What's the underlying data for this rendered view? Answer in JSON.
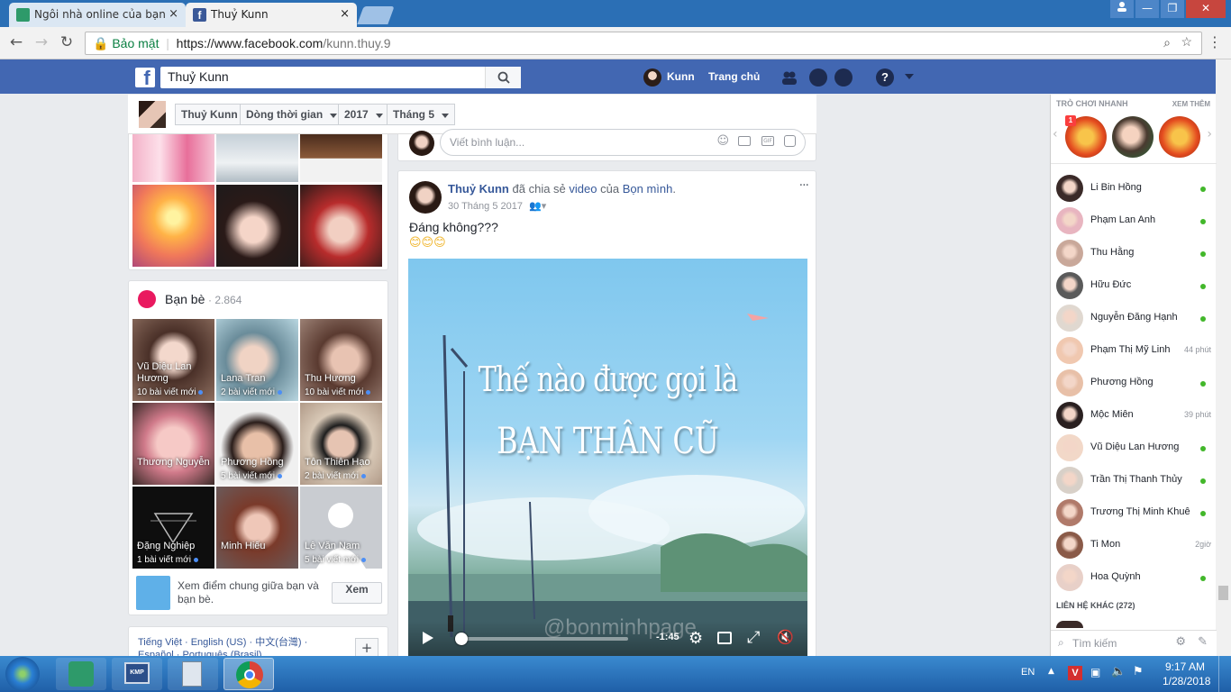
{
  "browser": {
    "tabs": [
      {
        "title": "Ngôi nhà online của bạn"
      },
      {
        "title": "Thuỷ Kunn"
      }
    ],
    "close_symbol": "×",
    "address": {
      "secure_label": "Bảo mật",
      "url_host": "https://www.facebook.com",
      "url_path": "/kunn.thuy.9"
    }
  },
  "fb_header": {
    "search_value": "Thuỷ Kunn",
    "user_name": "Kunn",
    "home_label": "Trang chủ"
  },
  "profile_nav": {
    "name_button": "Thuỷ Kunn",
    "timeline_button": "Dòng thời gian",
    "year_button": "2017",
    "month_button": "Tháng 5"
  },
  "friends": {
    "title": "Bạn bè",
    "count": "· 2.864",
    "items": [
      {
        "name": "Vũ Diệu Lan Hương",
        "posts": "10 bài viết mới"
      },
      {
        "name": "Lana Tran",
        "posts": "2 bài viết mới"
      },
      {
        "name": "Thu Hương",
        "posts": "10 bài viết mới"
      },
      {
        "name": "Thương Nguyễn",
        "posts": ""
      },
      {
        "name": "Phương Hồng",
        "posts": "5 bài viết mới"
      },
      {
        "name": "Tôn Thiên Hạo",
        "posts": "2 bài viết mới"
      },
      {
        "name": "Đặng Nghiệp",
        "posts": "1 bài viết mới"
      },
      {
        "name": "Minh Hiếu",
        "posts": ""
      },
      {
        "name": "Lê Văn Nam",
        "posts": "5 bài viết mới"
      }
    ],
    "common_text": "Xem điểm chung giữa bạn và bạn bè.",
    "see_button": "Xem"
  },
  "footer_langs": {
    "line1": "Tiếng Việt · English (US) · 中文(台灣) ·",
    "line2": "Español · Português (Brasil)",
    "plus": "+"
  },
  "comment_box": {
    "placeholder": "Viết bình luận..."
  },
  "post": {
    "author": "Thuỷ Kunn",
    "action_prefix": "đã chia sẻ",
    "action_link": "video",
    "action_mid": "của",
    "source_page": "Bọn mình",
    "date": "30 Tháng 5 2017",
    "text": "Đáng không???",
    "emoji": "😊😊😊",
    "menu": "···",
    "video": {
      "title_line1": "Thế nào được gọi là",
      "title_line2": "BẠN THÂN CŨ",
      "watermark": "@bonminhpage",
      "time_left": "-1:45",
      "progress": 0.0
    }
  },
  "chat": {
    "games_title": "TRÒ CHƠI NHANH",
    "games_more": "XEM THÊM",
    "game_badge": "1",
    "contacts": [
      {
        "name": "Li Bin Hồng",
        "status": "online"
      },
      {
        "name": "Phạm Lan Anh",
        "status": "online"
      },
      {
        "name": "Thu Hằng",
        "status": "online"
      },
      {
        "name": "Hữu Đức",
        "status": "online"
      },
      {
        "name": "Nguyễn Đăng Hạnh",
        "status": "online"
      },
      {
        "name": "Phạm Thị Mỹ Linh",
        "status": "44 phút"
      },
      {
        "name": "Phương Hồng",
        "status": "online"
      },
      {
        "name": "Mộc Miên",
        "status": "39 phút"
      },
      {
        "name": "Vũ Diệu Lan Hương",
        "status": "online"
      },
      {
        "name": "Trần Thị Thanh Thủy",
        "status": "online"
      },
      {
        "name": "Trương Thị Minh Khuê",
        "status": "online"
      },
      {
        "name": "Ti Mon",
        "status": "2giờ"
      },
      {
        "name": "Hoa Quỳnh",
        "status": "online"
      }
    ],
    "other_contacts": "LIÊN HỆ KHÁC (272)",
    "search_placeholder": "Tìm kiếm"
  },
  "taskbar": {
    "lang": "EN",
    "time": "9:17 AM",
    "date": "1/28/2018",
    "kmp_label": "KMP"
  },
  "colors": {
    "fb_blue": "#4267b2",
    "online": "#42b72a",
    "link": "#365899"
  }
}
